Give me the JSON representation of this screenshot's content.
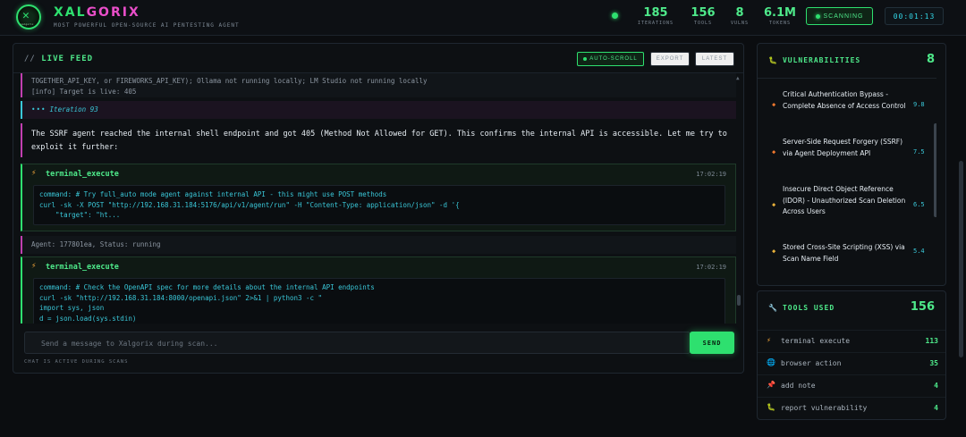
{
  "header": {
    "brand_part1": "XAL",
    "brand_part2": "GORIX",
    "logo_text": "xalgorix",
    "tagline": "MOST POWERFUL OPEN-SOURCE AI PENTESTING AGENT",
    "stats": [
      {
        "value": "185",
        "label": "ITERATIONS"
      },
      {
        "value": "156",
        "label": "TOOLS"
      },
      {
        "value": "8",
        "label": "VULNS"
      },
      {
        "value": "6.1M",
        "label": "TOKENS"
      }
    ],
    "scanning_label": "SCANNING",
    "timer": "00:01:13"
  },
  "feed": {
    "title_prefix": "//",
    "title": "LIVE FEED",
    "buttons": {
      "autoscroll": "AUTO-SCROLL",
      "export": "EXPORT",
      "latest": "LATEST"
    },
    "info_line1": "TOGETHER_API_KEY, or FIREWORKS_API_KEY); Ollama not running locally; LM Studio not running locally",
    "info_line2": "[info]   Target is live: 405",
    "iteration": "Iteration 93",
    "message": "The SSRF agent reached the internal shell endpoint and got 405 (Method Not Allowed for GET). This confirms the internal API is accessible. Let me try to exploit it further:",
    "tool_calls": [
      {
        "name": "terminal_execute",
        "time": "17:02:19",
        "code": "command: # Try full_auto mode agent against internal API - this might use POST methods\ncurl -sk -X POST \"http://192.168.31.184:5176/api/v1/agent/run\" -H \"Content-Type: application/json\" -d '{\n    \"target\": \"ht..."
      },
      {
        "name": "terminal_execute",
        "time": "17:02:19",
        "code": "command: # Check the OpenAPI spec for more details about the internal API endpoints\ncurl -sk \"http://192.168.31.184:8000/openapi.json\" 2>&1 | python3 -c \"\nimport sys, json\nd = json.load(sys.stdin)"
      }
    ],
    "agent_line": "Agent: 177801ea, Status: running"
  },
  "chat": {
    "placeholder": "Send a message to Xalgorix during scan...",
    "send_label": "SEND",
    "hint": "CHAT IS ACTIVE DURING SCANS"
  },
  "vulnerabilities": {
    "title": "VULNERABILITIES",
    "count": "8",
    "items": [
      {
        "title": "Critical Authentication Bypass - Complete Absence of Access Control",
        "score": "9.8",
        "color": "#f0782e"
      },
      {
        "title": "Server-Side Request Forgery (SSRF) via Agent Deployment API",
        "score": "7.5",
        "color": "#f0782e"
      },
      {
        "title": "Insecure Direct Object Reference (IDOR) - Unauthorized Scan Deletion Across Users",
        "score": "6.5",
        "color": "#e8b13a"
      },
      {
        "title": "Stored Cross-Site Scripting (XSS) via Scan Name Field",
        "score": "5.4",
        "color": "#e8b13a"
      }
    ]
  },
  "tools": {
    "title": "TOOLS USED",
    "count": "156",
    "items": [
      {
        "name": "terminal execute",
        "count": "113",
        "icon": "bolt-icon"
      },
      {
        "name": "browser action",
        "count": "35",
        "icon": "globe-icon"
      },
      {
        "name": "add note",
        "count": "4",
        "icon": "pin-icon"
      },
      {
        "name": "report vulnerability",
        "count": "4",
        "icon": "bug-icon"
      }
    ]
  }
}
